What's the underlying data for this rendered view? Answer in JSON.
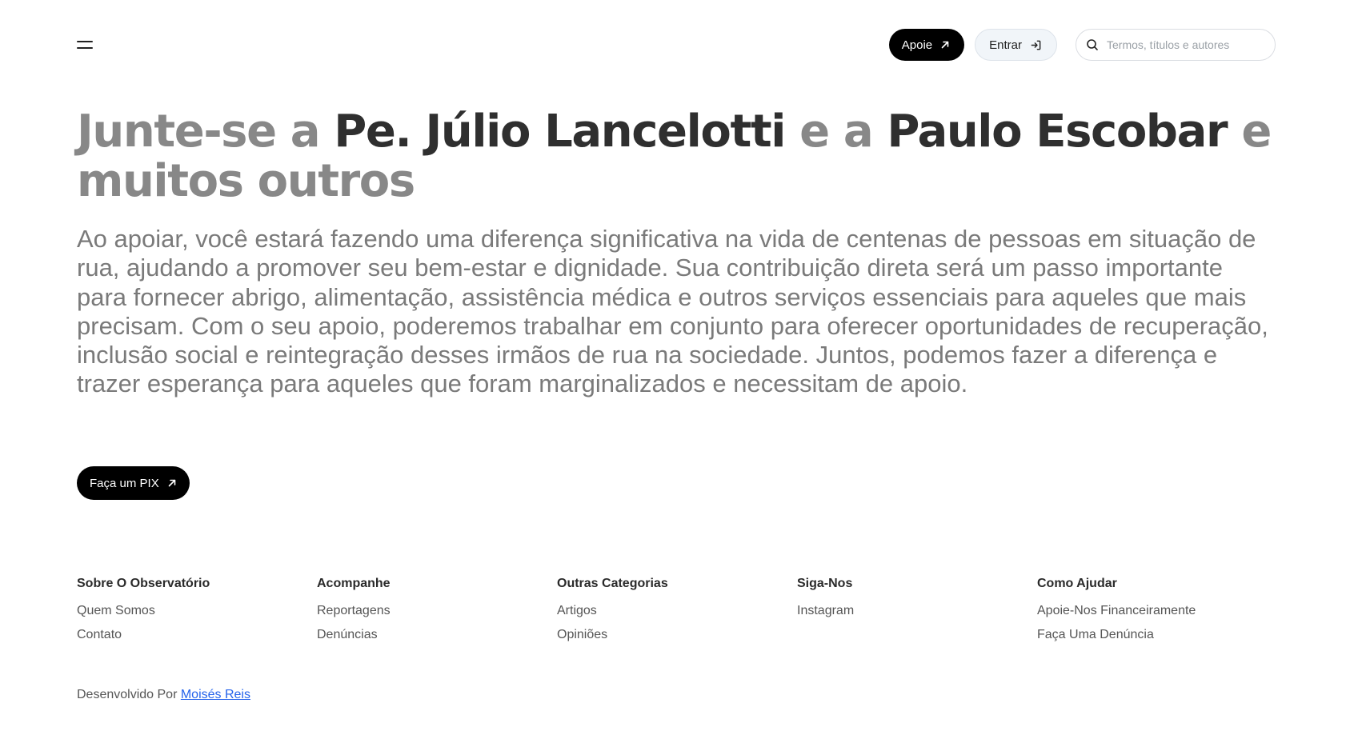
{
  "header": {
    "menu_icon": "hamburger-icon",
    "support_label": "Apoie",
    "support_icon": "arrow-up-right-icon",
    "login_label": "Entrar",
    "login_icon": "log-in-icon",
    "search": {
      "placeholder": "Termos, títulos e autores",
      "icon": "search-icon"
    }
  },
  "hero": {
    "title_part1": "Junte-se a ",
    "name1": "Pe. Júlio Lancelotti",
    "title_part2": " e a ",
    "name2": "Paulo Escobar",
    "title_part3": " e muitos outros",
    "body": "Ao apoiar, você estará fazendo uma diferença significativa na vida de centenas de pessoas em situação de rua, ajudando a promover seu bem-estar e dignidade. Sua contribuição direta será um passo importante para fornecer abrigo, alimentação, assistência médica e outros serviços essenciais para aqueles que mais precisam. Com o seu apoio, poderemos trabalhar em conjunto para oferecer oportunidades de recuperação, inclusão social e reintegração desses irmãos de rua na sociedade. Juntos, podemos fazer a diferença e trazer esperança para aqueles que foram marginalizados e necessitam de apoio.",
    "cta_label": "Faça um PIX",
    "cta_icon": "arrow-up-right-icon"
  },
  "footer": {
    "columns": [
      {
        "title": "Sobre O Observatório",
        "links": [
          "Quem Somos",
          "Contato"
        ]
      },
      {
        "title": "Acompanhe",
        "links": [
          "Reportagens",
          "Denúncias"
        ]
      },
      {
        "title": "Outras Categorias",
        "links": [
          "Artigos",
          "Opiniões"
        ]
      },
      {
        "title": "Siga-Nos",
        "links": [
          "Instagram"
        ]
      },
      {
        "title": "Como Ajudar",
        "links": [
          "Apoie-Nos Financeiramente",
          "Faça Uma Denúncia"
        ]
      }
    ],
    "credit_prefix": "Desenvolvido Por ",
    "credit_name": "Moisés Reis"
  },
  "colors": {
    "primary_button": "#000000",
    "title_muted": "#888888",
    "title_strong": "#2f2f2f",
    "link_accent": "#2563eb"
  }
}
